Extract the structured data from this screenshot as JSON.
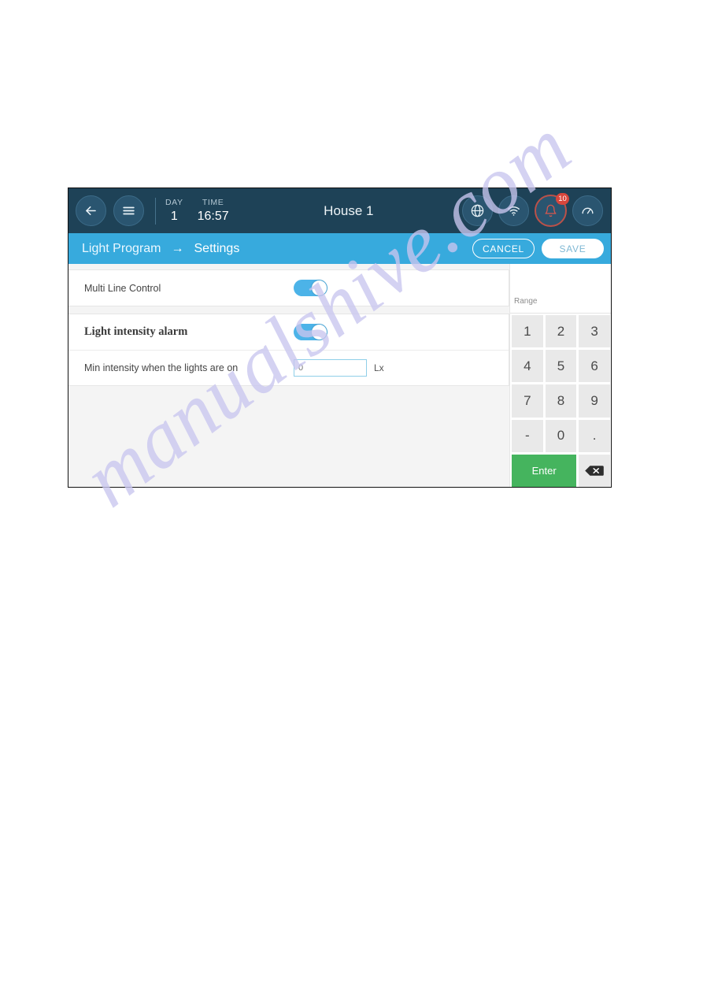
{
  "watermark": {
    "text": "manualshive.com"
  },
  "topbar": {
    "back_icon": "arrow-left-icon",
    "menu_icon": "hamburger-menu-icon",
    "day_label": "DAY",
    "day_value": "1",
    "time_label": "TIME",
    "time_value": "16:57",
    "title": "House 1",
    "globe_icon": "globe-icon",
    "wifi_icon": "wifi-icon",
    "alarm_icon": "bell-icon",
    "alarm_count": "10",
    "gauge_icon": "gauge-icon",
    "bg_color": "#1e4257"
  },
  "breadcrumb": {
    "parent": "Light Program",
    "arrow": "→",
    "current": "Settings",
    "cancel_label": "CANCEL",
    "save_label": "SAVE",
    "bg_color": "#37aadd"
  },
  "settings": {
    "cards": [
      {
        "rows": [
          {
            "label": "Multi Line Control",
            "control": "toggle",
            "state": "on"
          }
        ]
      },
      {
        "rows": [
          {
            "label": "Light intensity alarm",
            "control": "toggle",
            "state": "on",
            "emphasis": "bold-serif"
          },
          {
            "label": "Min intensity when the lights are on",
            "control": "input",
            "value": "0",
            "unit": "Lx"
          }
        ]
      }
    ],
    "toggle_on_color": "#4cb3e8",
    "input_border_color": "#8fcfe8"
  },
  "keypad": {
    "range_label": "Range",
    "range_value": "",
    "keys": [
      "1",
      "2",
      "3",
      "4",
      "5",
      "6",
      "7",
      "8",
      "9",
      "-",
      "0",
      "."
    ],
    "enter_label": "Enter",
    "backspace_icon": "backspace-icon",
    "enter_color": "#45b45e",
    "key_color": "#e9e9e9"
  }
}
